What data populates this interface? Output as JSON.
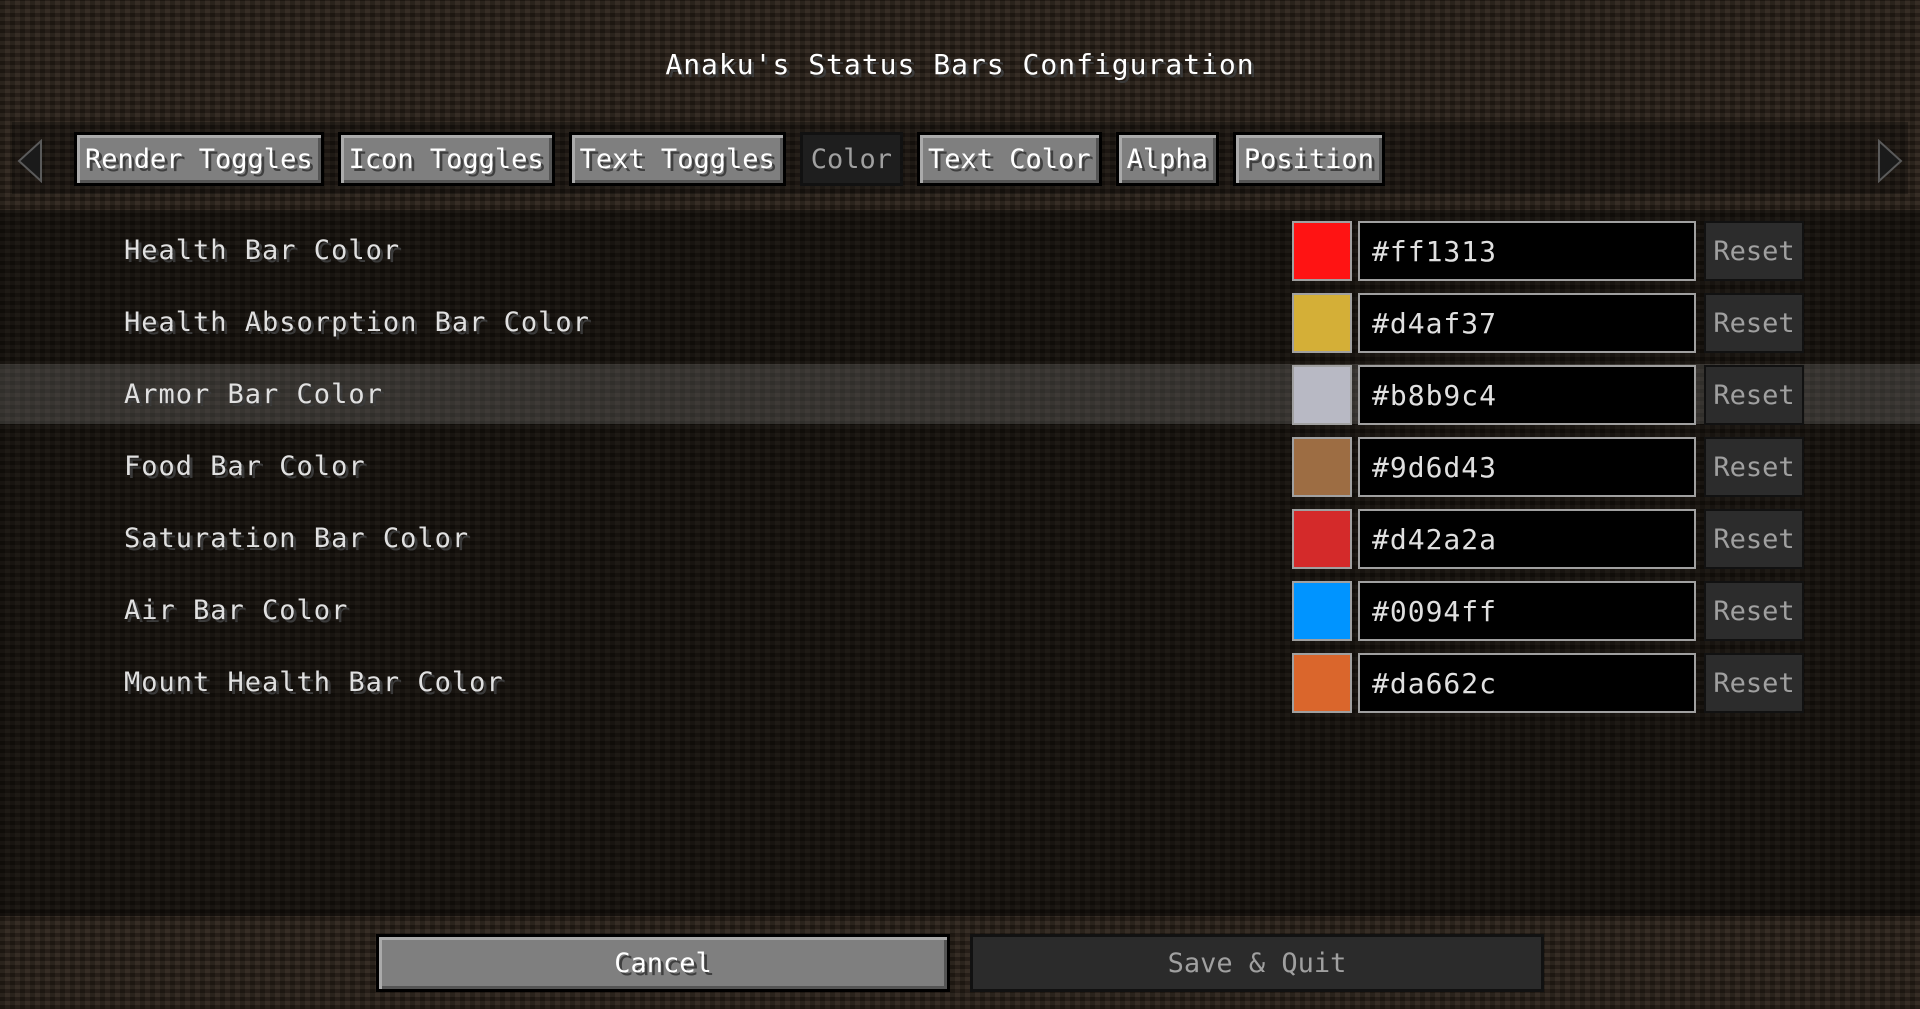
{
  "title": "Anaku's Status Bars Configuration",
  "tabs": [
    {
      "label": "Render Toggles",
      "active": false
    },
    {
      "label": "Icon Toggles",
      "active": false
    },
    {
      "label": "Text Toggles",
      "active": false
    },
    {
      "label": "Color",
      "active": true
    },
    {
      "label": "Text Color",
      "active": false
    },
    {
      "label": "Alpha",
      "active": false
    },
    {
      "label": "Position",
      "active": false
    }
  ],
  "nav": {
    "left_icon": "arrow-left-icon",
    "right_icon": "arrow-right-icon"
  },
  "settings": [
    {
      "label": "Health Bar Color",
      "hex": "#ff1313",
      "reset": "Reset"
    },
    {
      "label": "Health Absorption Bar Color",
      "hex": "#d4af37",
      "reset": "Reset"
    },
    {
      "label": "Armor Bar Color",
      "hex": "#b8b9c4",
      "reset": "Reset"
    },
    {
      "label": "Food Bar Color",
      "hex": "#9d6d43",
      "reset": "Reset"
    },
    {
      "label": "Saturation Bar Color",
      "hex": "#d42a2a",
      "reset": "Reset"
    },
    {
      "label": "Air Bar Color",
      "hex": "#0094ff",
      "reset": "Reset"
    },
    {
      "label": "Mount Health Bar Color",
      "hex": "#da662c",
      "reset": "Reset"
    }
  ],
  "highlighted_row": 2,
  "footer": {
    "cancel_label": "Cancel",
    "save_label": "Save & Quit"
  }
}
